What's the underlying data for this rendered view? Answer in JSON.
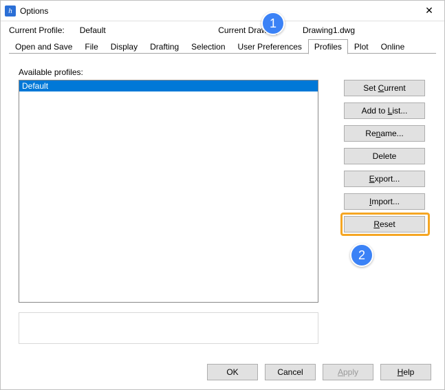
{
  "window": {
    "title": "Options",
    "app_icon_text": "h",
    "close_glyph": "✕"
  },
  "info": {
    "profile_label": "Current Profile:",
    "profile_value": "Default",
    "drawing_label": "Current Drawing:",
    "drawing_value": "Drawing1.dwg"
  },
  "tabs": [
    "Open and Save",
    "File",
    "Display",
    "Drafting",
    "Selection",
    "User Preferences",
    "Profiles",
    "Plot",
    "Online"
  ],
  "active_tab": "Profiles",
  "profiles_panel": {
    "available_label": "Available profiles:",
    "list": [
      "Default"
    ],
    "selected_index": 0
  },
  "side_buttons": {
    "set_current_pre": "Set ",
    "set_current_u": "C",
    "set_current_post": "urrent",
    "add_to_list_pre": "Add to ",
    "add_to_list_u": "L",
    "add_to_list_post": "ist...",
    "rename_pre": "Re",
    "rename_u": "n",
    "rename_post": "ame...",
    "delete": "Delete",
    "export_pre": "",
    "export_u": "E",
    "export_post": "xport...",
    "import_pre": "",
    "import_u": "I",
    "import_post": "mport...",
    "reset_pre": "",
    "reset_u": "R",
    "reset_post": "eset"
  },
  "bottom_buttons": {
    "ok": "OK",
    "cancel": "Cancel",
    "apply_pre": "",
    "apply_u": "A",
    "apply_post": "pply",
    "help_pre": "",
    "help_u": "H",
    "help_post": "elp"
  },
  "callouts": {
    "one": "1",
    "two": "2"
  }
}
